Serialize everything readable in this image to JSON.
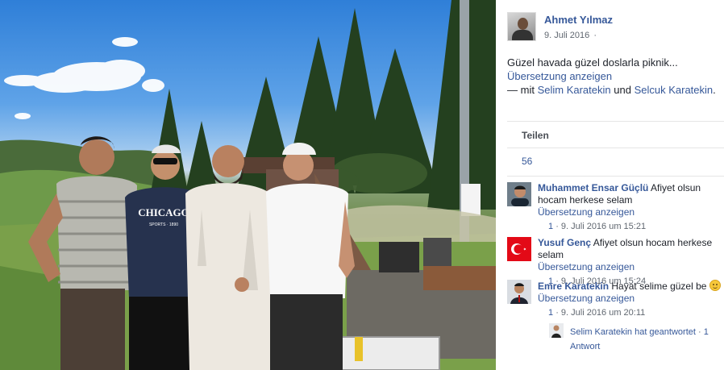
{
  "post": {
    "author": "Ahmet Yılmaz",
    "date": "9. Juli 2016",
    "date_suffix": "·",
    "text": "Güzel havada güzel doslarla piknik...",
    "translate": "Übersetzung anzeigen",
    "tagged_prefix": "— mit",
    "tagged_person_1": "Selim Karatekin",
    "tagged_join": "und",
    "tagged_person_2": "Selcuk Karatekin",
    "tagged_end": "."
  },
  "photo": {
    "shirt_text": "CHICAGO",
    "shirt_subtext": "SPORTS · 1890"
  },
  "actions": {
    "share": "Teilen",
    "likes": "56"
  },
  "comments": [
    {
      "name": "Muhammet Ensar Güçlü",
      "text": "Afiyet olsun hocam herkese selam",
      "translate": "Übersetzung anzeigen",
      "likes": "1",
      "meta": "· 9. Juli 2016 um 15:21"
    },
    {
      "name": "Yusuf Genç",
      "text": "Afiyet olsun hocam herkese selam",
      "translate": "Übersetzung anzeigen",
      "likes": "1",
      "meta": "· 9. Juli 2016 um 15:24"
    },
    {
      "name": "Emre Karatekin",
      "text": "Hayat selime güzel be",
      "translate": "Übersetzung anzeigen",
      "likes": "1",
      "meta": "· 9. Juli 2016 um 20:11"
    }
  ],
  "reply": {
    "text": "Selim Karatekin hat geantwortet",
    "sep": "·",
    "count": "1 Antwort"
  },
  "colors": {
    "link": "#365899",
    "meta": "#606770",
    "divider": "#e5e5e5"
  }
}
